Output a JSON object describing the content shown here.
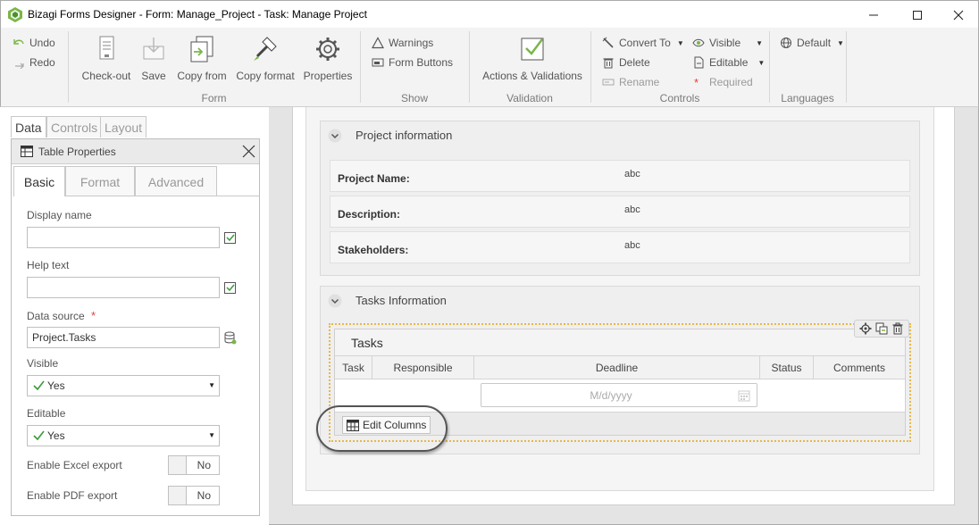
{
  "window": {
    "title": "Bizagi Forms Designer  - Form: Manage_Project - Task:  Manage Project",
    "controls": [
      "minimize",
      "maximize",
      "close"
    ]
  },
  "ribbon": {
    "undo": "Undo",
    "redo": "Redo",
    "form_group": {
      "label": "Form",
      "checkout": "Check-out",
      "save": "Save",
      "copy_from": "Copy from",
      "copy_format": "Copy format",
      "properties": "Properties"
    },
    "show_group": {
      "label": "Show",
      "warnings": "Warnings",
      "form_buttons": "Form Buttons"
    },
    "validation_group": {
      "label": "Validation",
      "actions": "Actions & Validations"
    },
    "controls_group": {
      "label": "Controls",
      "convert_to": "Convert To",
      "delete": "Delete",
      "rename": "Rename",
      "visible": "Visible",
      "editable": "Editable",
      "required": "Required"
    },
    "languages_group": {
      "label": "Languages",
      "default": "Default"
    }
  },
  "left_panel": {
    "tabs": [
      "Data",
      "Controls",
      "Layout"
    ],
    "active_tab": "Data",
    "properties": {
      "title": "Table Properties",
      "tabs": [
        "Basic",
        "Format",
        "Advanced"
      ],
      "active_tab": "Basic",
      "display_name_label": "Display name",
      "display_name_value": "",
      "help_text_label": "Help text",
      "help_text_value": "",
      "data_source_label": "Data source",
      "data_source_required_mark": "*",
      "data_source_value": "Project.Tasks",
      "visible_label": "Visible",
      "visible_value": "Yes",
      "editable_label": "Editable",
      "editable_value": "Yes",
      "excel_label": "Enable Excel export",
      "excel_value": "No",
      "pdf_label": "Enable PDF export",
      "pdf_value": "No"
    }
  },
  "form": {
    "project_group": {
      "title": "Project information",
      "fields": [
        {
          "label": "Project Name:",
          "value": "abc"
        },
        {
          "label": "Description:",
          "value": "abc"
        },
        {
          "label": "Stakeholders:",
          "value": "abc"
        }
      ]
    },
    "tasks_group": {
      "title": "Tasks Information",
      "grid": {
        "title": "Tasks",
        "columns": [
          "Task",
          "Responsible",
          "Deadline",
          "Status",
          "Comments"
        ],
        "date_placeholder": "M/d/yyyy",
        "edit_columns": "Edit Columns"
      }
    }
  },
  "colors": {
    "ribbon_bg": "#f3f3f3",
    "canvas_bg": "#e4e4e4",
    "selection_dotted": "#e6b84a",
    "check_green": "#3a9a3a",
    "required_red": "#e0403a"
  }
}
